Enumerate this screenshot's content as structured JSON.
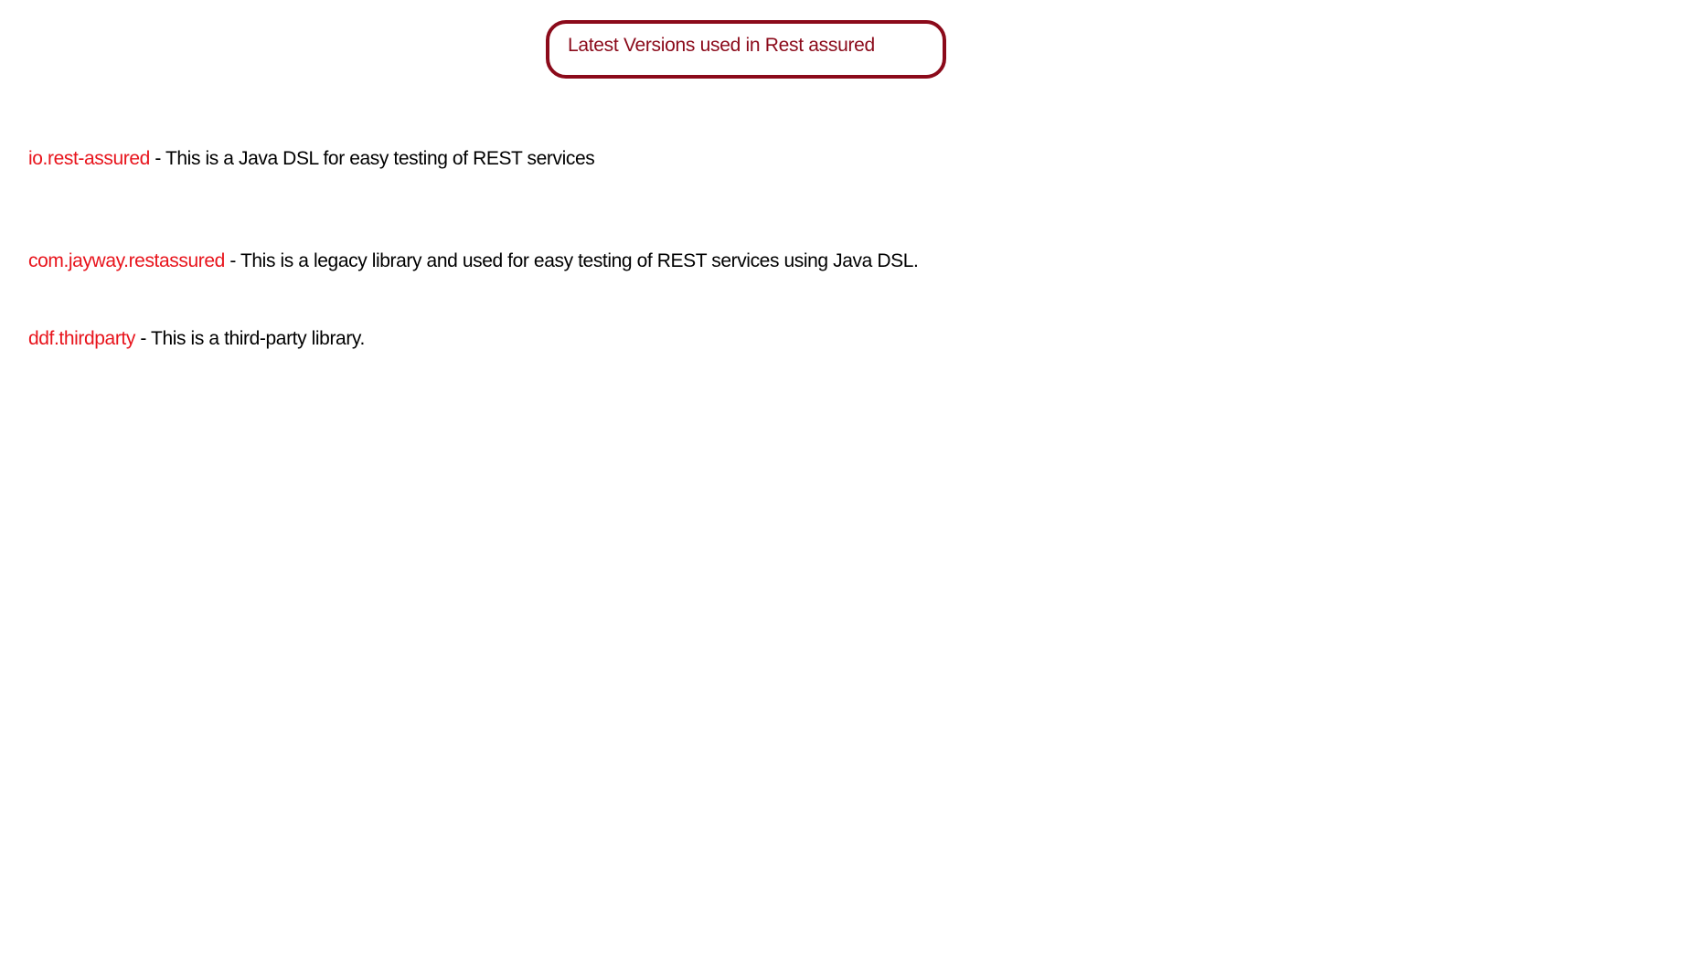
{
  "title": "Latest Versions used in Rest assured",
  "items": [
    {
      "package": "io.rest-assured",
      "description": " - This is a Java DSL for easy testing of REST services"
    },
    {
      "package": "com.jayway.restassured",
      "description": " - This is a legacy library and used for easy testing of REST services using Java DSL."
    },
    {
      "package": "ddf.thirdparty",
      "description": " - This is a third-party library."
    }
  ],
  "colors": {
    "title": "#8b0a1a",
    "package": "#e8141c",
    "text": "#000000"
  }
}
